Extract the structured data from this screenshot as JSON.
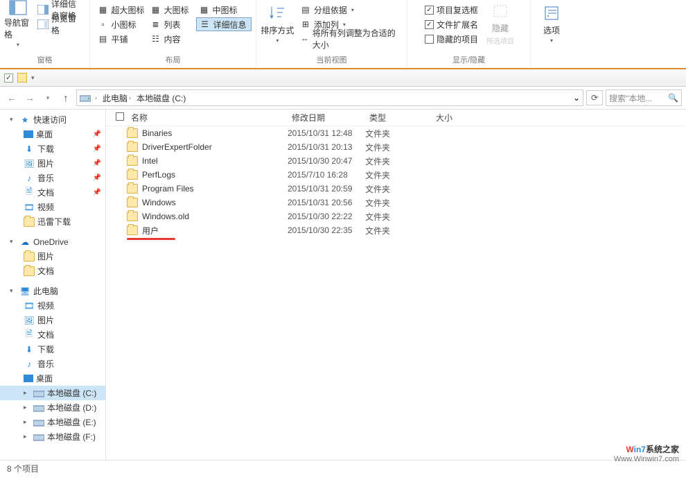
{
  "ribbon": {
    "panes": {
      "label": "窗格",
      "navPane": "导航窗格",
      "detailPane": "详细信息窗格",
      "previewPane": "预览窗格"
    },
    "layout": {
      "label": "布局",
      "xl": "超大图标",
      "lg": "大图标",
      "md": "中图标",
      "sm": "小图标",
      "list": "列表",
      "details": "详细信息",
      "tiles": "平铺",
      "content": "内容"
    },
    "view": {
      "label": "当前视图",
      "sortBy": "排序方式",
      "groupBy": "分组依据",
      "addCol": "添加列",
      "fitAll": "将所有列调整为合适的大小"
    },
    "showhide": {
      "label": "显示/隐藏",
      "chkBoxes": "项目复选框",
      "ext": "文件扩展名",
      "hidden": "隐藏的项目",
      "hide": "隐藏",
      "hideSub": "所选项目"
    },
    "options": {
      "label": "选项"
    }
  },
  "nav": {
    "thisPC": "此电脑",
    "drive": "本地磁盘 (C:)",
    "searchPlaceholder": "搜索\"本地..."
  },
  "cols": {
    "name": "名称",
    "date": "修改日期",
    "type": "类型",
    "size": "大小"
  },
  "tree": {
    "quick": "快速访问",
    "desktop": "桌面",
    "downloads": "下载",
    "pictures": "图片",
    "music": "音乐",
    "documents": "文档",
    "videos": "视频",
    "thunder": "迅雷下载",
    "onedrive": "OneDrive",
    "odPic": "图片",
    "odDoc": "文档",
    "thispc": "此电脑",
    "pcVid": "视频",
    "pcPic": "图片",
    "pcDoc": "文档",
    "pcDl": "下载",
    "pcMus": "音乐",
    "pcDesk": "桌面",
    "driveC": "本地磁盘 (C:)",
    "driveD": "本地磁盘 (D:)",
    "driveE": "本地磁盘 (E:)",
    "driveF": "本地磁盘 (F:)"
  },
  "files": [
    {
      "name": "Binaries",
      "date": "2015/10/31 12:48",
      "type": "文件夹"
    },
    {
      "name": "DriverExpertFolder",
      "date": "2015/10/31 20:13",
      "type": "文件夹"
    },
    {
      "name": "Intel",
      "date": "2015/10/30 20:47",
      "type": "文件夹"
    },
    {
      "name": "PerfLogs",
      "date": "2015/7/10 16:28",
      "type": "文件夹"
    },
    {
      "name": "Program Files",
      "date": "2015/10/31 20:59",
      "type": "文件夹"
    },
    {
      "name": "Windows",
      "date": "2015/10/31 20:56",
      "type": "文件夹"
    },
    {
      "name": "Windows.old",
      "date": "2015/10/30 22:22",
      "type": "文件夹"
    },
    {
      "name": "用户",
      "date": "2015/10/30 22:35",
      "type": "文件夹"
    }
  ],
  "status": "8 个项目",
  "watermark": {
    "l1": "Win7系统之家",
    "l2": "Www.Winwin7.com"
  }
}
